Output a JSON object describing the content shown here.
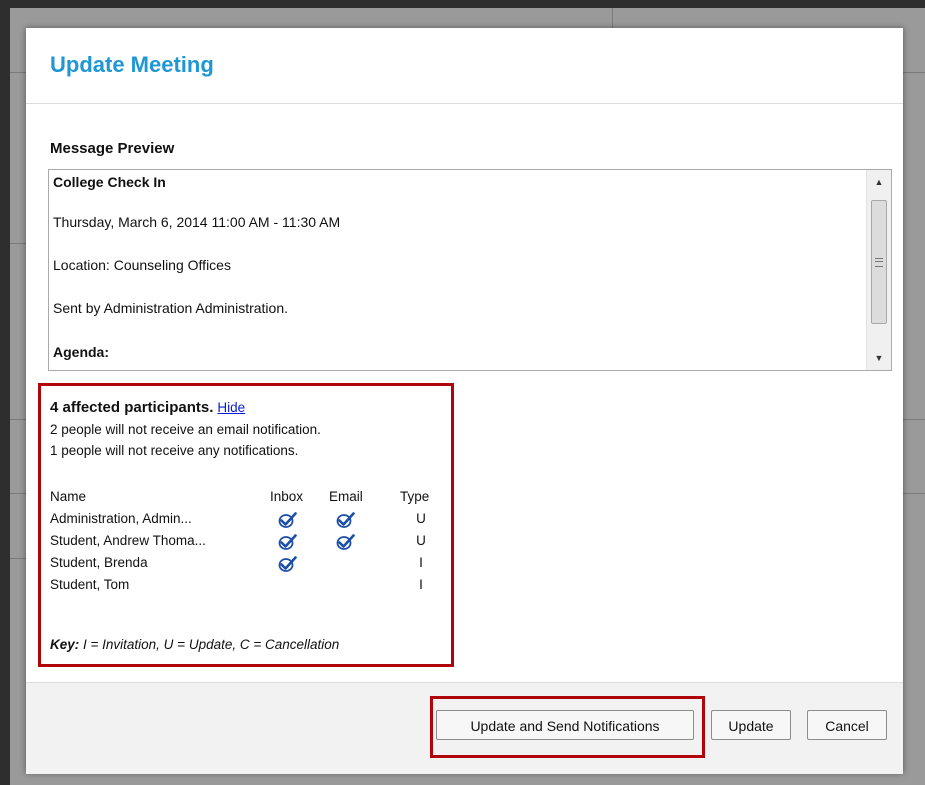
{
  "dialog": {
    "title": "Update Meeting",
    "message_preview_label": "Message Preview"
  },
  "preview": {
    "subject": "College Check In",
    "datetime": "Thursday, March 6, 2014 11:00 AM - 11:30 AM",
    "location": "Location: Counseling Offices",
    "sender": "Sent by Administration Administration.",
    "agenda_label": "Agenda:"
  },
  "affected": {
    "title": "4 affected participants.",
    "hide_link": "Hide",
    "no_email_note": "2 people will not receive an email notification.",
    "no_notify_note": "1 people will not receive any notifications.",
    "columns": {
      "name": "Name",
      "inbox": "Inbox",
      "email": "Email",
      "type": "Type"
    },
    "participants": [
      {
        "name": "Administration, Admin...",
        "inbox": true,
        "email": true,
        "type": "U"
      },
      {
        "name": "Student, Andrew Thoma...",
        "inbox": true,
        "email": true,
        "type": "U"
      },
      {
        "name": "Student, Brenda",
        "inbox": true,
        "email": false,
        "type": "I"
      },
      {
        "name": "Student, Tom",
        "inbox": false,
        "email": false,
        "type": "I"
      }
    ],
    "key_label": "Key:",
    "key_text": " I = Invitation, U = Update, C = Cancellation"
  },
  "footer": {
    "send_label": "Update and Send Notifications",
    "update_label": "Update",
    "cancel_label": "Cancel"
  },
  "icons": {
    "check": "check-circle-icon",
    "scroll_up": "arrow-up-icon",
    "scroll_down": "arrow-down-icon"
  },
  "colors": {
    "title": "#1f97d4",
    "highlight": "#b0050b",
    "link": "#0b1bd6",
    "check": "#1b4fa8"
  }
}
